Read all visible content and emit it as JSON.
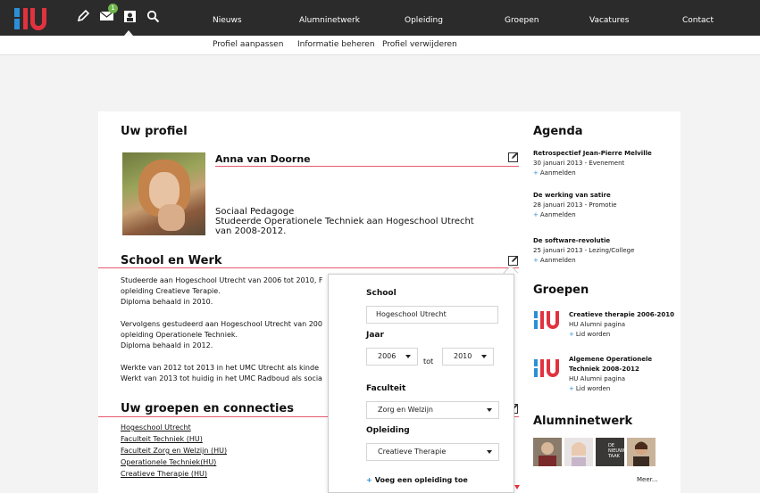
{
  "header": {
    "nav": [
      {
        "label": "Nieuws"
      },
      {
        "label": "Alumninetwerk"
      },
      {
        "label": "Opleiding"
      },
      {
        "label": "Groepen"
      },
      {
        "label": "Vacatures"
      },
      {
        "label": "Contact"
      }
    ],
    "mail_badge": "1",
    "colors": {
      "bar": "#2b2b2b",
      "logo_blue": "#2b8fd6",
      "logo_red": "#e1323f",
      "accent_line": "#e85a6e"
    }
  },
  "subnav": [
    {
      "label": "Profiel aanpassen"
    },
    {
      "label": "Informatie beheren"
    },
    {
      "label": "Profiel verwijderen"
    }
  ],
  "profile": {
    "heading": "Uw profiel",
    "name": "Anna van Doorne",
    "lines": [
      "Sociaal Pedagoge",
      "Studeerde Operationele Techniek aan Hogeschool Utrecht",
      "van 2008-2012."
    ]
  },
  "school": {
    "heading": "School en Werk",
    "lines": [
      "Studeerde aan Hogeschool Utrecht van 2006 tot 2010, F",
      "opleiding Creatieve Terapie.",
      "Diploma behaald in 2010.",
      "",
      "Vervolgens gestudeerd aan Hogeschool Utrecht van 200",
      "opleiding Operationele Techniek.",
      "Diploma behaald in 2012.",
      "",
      "Werkte van 2012 tot 2013 in het UMC Utrecht als kinde",
      "Werkt van 2013 tot huidig in het UMC Radboud als socia"
    ]
  },
  "groups_section": {
    "heading": "Uw groepen en connecties",
    "items": [
      "Hogeschool Utrecht",
      "Faculteit Techniek (HU)",
      "Faculteit Zorg en Welzijn (HU)",
      "Operationele Techniek(HU)",
      "Creatieve Therapie (HU)"
    ]
  },
  "agenda": {
    "heading": "Agenda",
    "items": [
      {
        "title": "Retrospectief Jean-Pierre Melville",
        "meta": "30 januari 2013 - Evenement",
        "action": "Aanmelden"
      },
      {
        "title": "De werking van satire",
        "meta": "28 januari 2013 - Promotie",
        "action": "Aanmelden"
      },
      {
        "title": "De software-revolutie",
        "meta": "25 januari 2013 - Lezing/College",
        "action": "Aanmelden"
      }
    ]
  },
  "sidebar_groups": {
    "heading": "Groepen",
    "items": [
      {
        "title_line1": "Creatieve therapie  2006-2010",
        "title_line2": "",
        "meta": "HU Alumni pagina",
        "action": "Lid worden"
      },
      {
        "title_line1": "Algemene Operationele",
        "title_line2": "Techniek 2008-2012",
        "meta": "HU Alumni pagina",
        "action": "Lid worden"
      }
    ]
  },
  "alumni": {
    "heading": "Alumninetwerk",
    "thumb3_text": "DE NIEUWE TAAK",
    "more": "Meer..."
  },
  "popover": {
    "school_label": "School",
    "school_value": "Hogeschool Utrecht",
    "year_label": "Jaar",
    "year_from": "2006",
    "year_sep": "tot",
    "year_to": "2010",
    "faculty_label": "Faculteit",
    "faculty_value": "Zorg en Welzijn",
    "program_label": "Opleiding",
    "program_value": "Creatieve Therapie",
    "add_program": "Voeg een opleiding toe"
  }
}
